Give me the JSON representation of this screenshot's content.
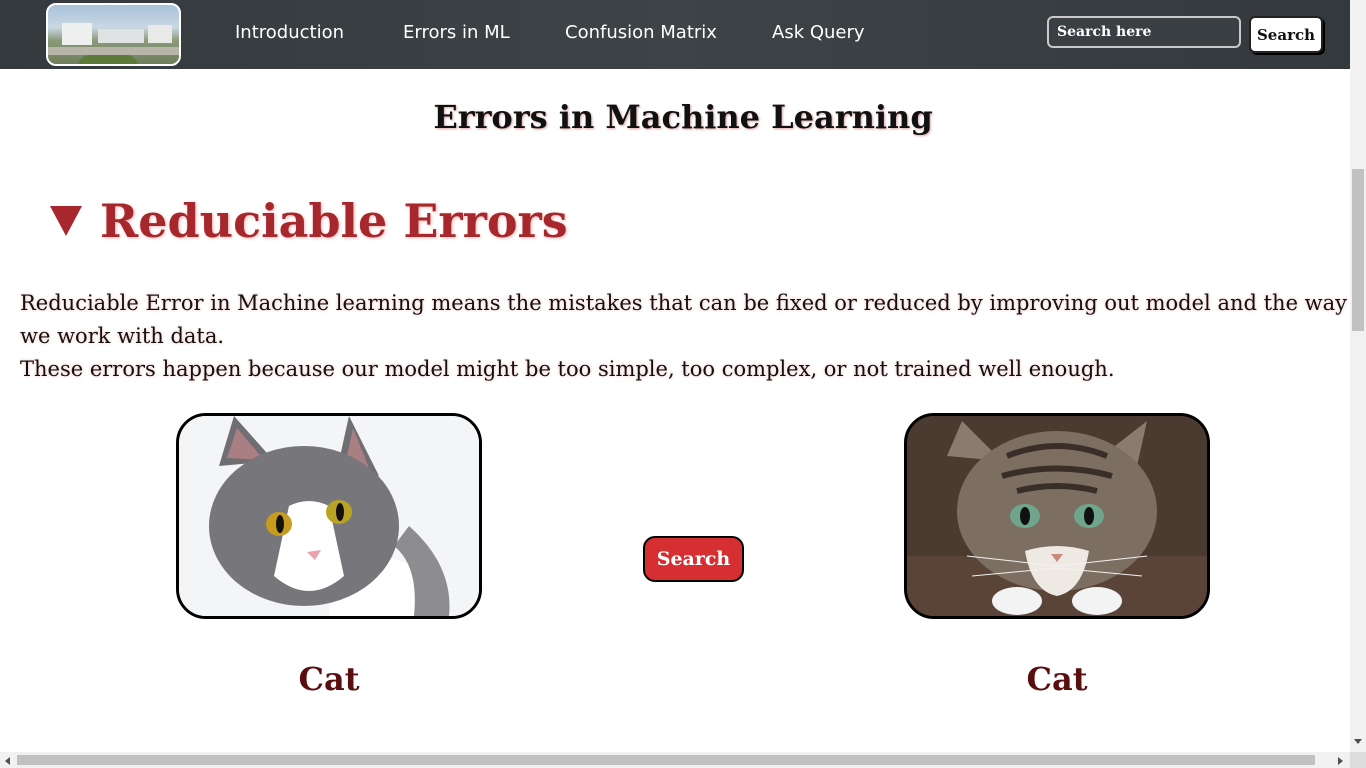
{
  "navbar": {
    "links": [
      {
        "label": "Introduction"
      },
      {
        "label": "Errors in ML"
      },
      {
        "label": "Confusion Matrix"
      },
      {
        "label": "Ask Query"
      }
    ],
    "search_placeholder": "Search here",
    "search_button": "Search"
  },
  "main": {
    "title": "Errors in Machine Learning",
    "section_heading": "Reduciable Errors",
    "description_line1": "Reduciable Error in Machine learning means the mistakes that can be fixed or reduced by improving out model and the way we work with data.",
    "description_line2": "These errors happen because our model might be too simple, too complex, or not trained well enough.",
    "center_button": "Search",
    "captions": [
      "Cat",
      "Cat"
    ]
  },
  "colors": {
    "navbar": "#3a3f43",
    "heading_red": "#a6282c",
    "button_red": "#d62f32",
    "caption_maroon": "#5a0e10"
  }
}
